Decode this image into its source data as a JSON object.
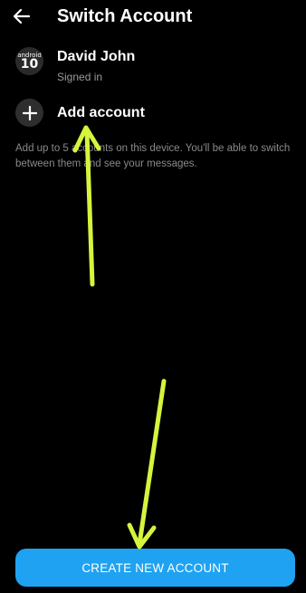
{
  "colors": {
    "background": "#000000",
    "accent": "#1fa2f2",
    "secondary_text": "#9a9a9a",
    "annotation_arrow": "#d4f53c"
  },
  "header": {
    "back_icon": "arrow-left-icon",
    "title": "Switch Account"
  },
  "accounts": [
    {
      "avatar_text_line1": "android",
      "avatar_text_line2": "10",
      "name": "David John",
      "status": "Signed in"
    }
  ],
  "add_account": {
    "icon": "plus-icon",
    "label": "Add account"
  },
  "info": {
    "text": "Add up to 5 accounts on this device. You'll be able to switch between them and see your messages."
  },
  "footer": {
    "create_button_label": "CREATE NEW ACCOUNT"
  },
  "annotations": [
    {
      "icon": "arrow-up-annotation-icon"
    },
    {
      "icon": "arrow-down-annotation-icon"
    }
  ]
}
